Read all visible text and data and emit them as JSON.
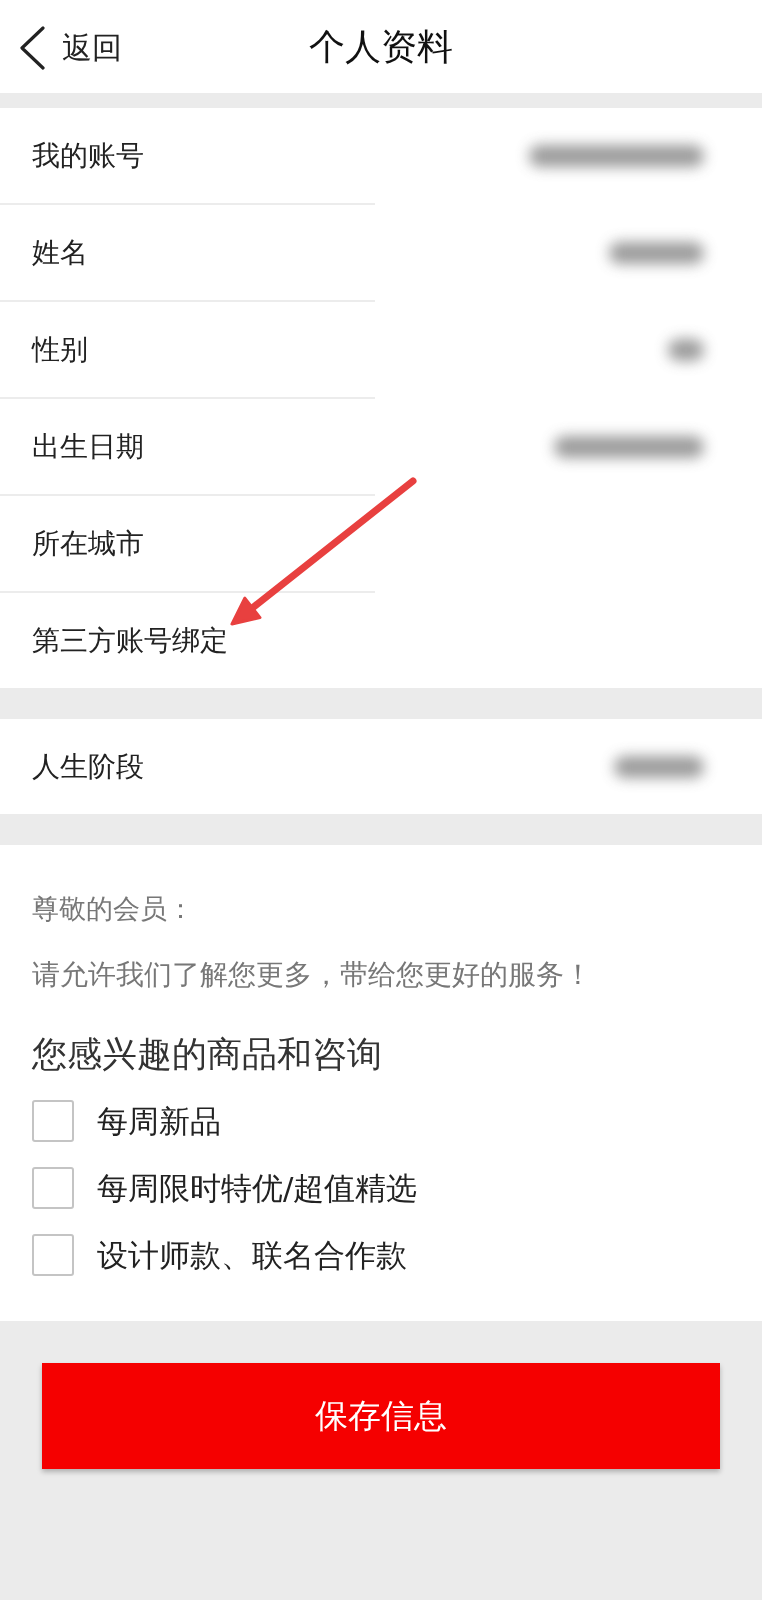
{
  "header": {
    "back_label": "返回",
    "title": "个人资料"
  },
  "groups": [
    {
      "rows": [
        {
          "label": "我的账号",
          "redacted_value": true
        },
        {
          "label": "姓名",
          "redacted_value": true
        },
        {
          "label": "性别",
          "redacted_value": true
        },
        {
          "label": "出生日期",
          "redacted_value": true
        },
        {
          "label": "所在城市",
          "redacted_value": false
        },
        {
          "label": "第三方账号绑定",
          "redacted_value": false
        }
      ]
    },
    {
      "rows": [
        {
          "label": "人生阶段",
          "redacted_value": true
        }
      ]
    }
  ],
  "annotation": {
    "kind": "arrow"
  },
  "interests": {
    "greeting": "尊敬的会员：",
    "message": "请允许我们了解您更多，带给您更好的服务！",
    "heading": "您感兴趣的商品和咨询",
    "options": [
      {
        "label": "每周新品",
        "checked": false
      },
      {
        "label": "每周限时特优/超值精选",
        "checked": false
      },
      {
        "label": "设计师款、联名合作款",
        "checked": false
      }
    ]
  },
  "save_button": "保存信息"
}
